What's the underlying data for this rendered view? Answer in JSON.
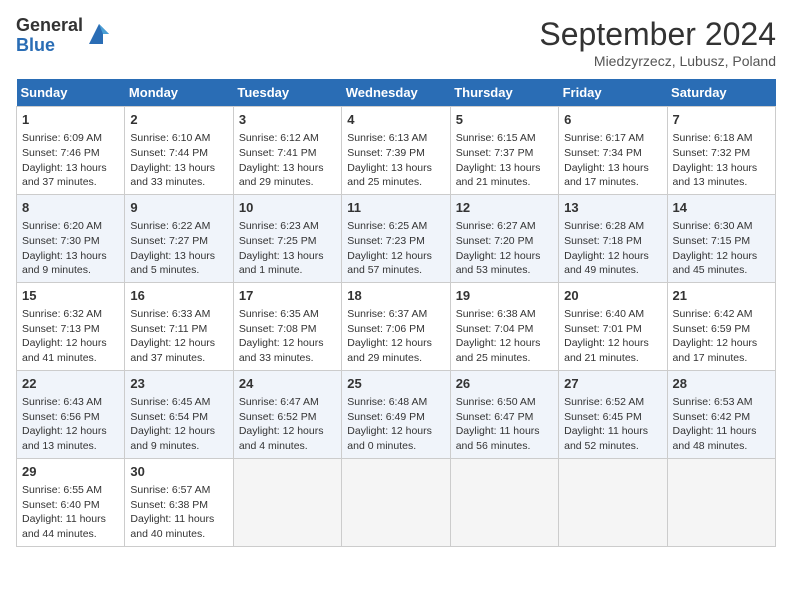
{
  "logo": {
    "general": "General",
    "blue": "Blue"
  },
  "header": {
    "month": "September 2024",
    "location": "Miedzyrzecz, Lubusz, Poland"
  },
  "weekdays": [
    "Sunday",
    "Monday",
    "Tuesday",
    "Wednesday",
    "Thursday",
    "Friday",
    "Saturday"
  ],
  "weeks": [
    [
      {
        "day": "1",
        "info": "Sunrise: 6:09 AM\nSunset: 7:46 PM\nDaylight: 13 hours\nand 37 minutes."
      },
      {
        "day": "2",
        "info": "Sunrise: 6:10 AM\nSunset: 7:44 PM\nDaylight: 13 hours\nand 33 minutes."
      },
      {
        "day": "3",
        "info": "Sunrise: 6:12 AM\nSunset: 7:41 PM\nDaylight: 13 hours\nand 29 minutes."
      },
      {
        "day": "4",
        "info": "Sunrise: 6:13 AM\nSunset: 7:39 PM\nDaylight: 13 hours\nand 25 minutes."
      },
      {
        "day": "5",
        "info": "Sunrise: 6:15 AM\nSunset: 7:37 PM\nDaylight: 13 hours\nand 21 minutes."
      },
      {
        "day": "6",
        "info": "Sunrise: 6:17 AM\nSunset: 7:34 PM\nDaylight: 13 hours\nand 17 minutes."
      },
      {
        "day": "7",
        "info": "Sunrise: 6:18 AM\nSunset: 7:32 PM\nDaylight: 13 hours\nand 13 minutes."
      }
    ],
    [
      {
        "day": "8",
        "info": "Sunrise: 6:20 AM\nSunset: 7:30 PM\nDaylight: 13 hours\nand 9 minutes."
      },
      {
        "day": "9",
        "info": "Sunrise: 6:22 AM\nSunset: 7:27 PM\nDaylight: 13 hours\nand 5 minutes."
      },
      {
        "day": "10",
        "info": "Sunrise: 6:23 AM\nSunset: 7:25 PM\nDaylight: 13 hours\nand 1 minute."
      },
      {
        "day": "11",
        "info": "Sunrise: 6:25 AM\nSunset: 7:23 PM\nDaylight: 12 hours\nand 57 minutes."
      },
      {
        "day": "12",
        "info": "Sunrise: 6:27 AM\nSunset: 7:20 PM\nDaylight: 12 hours\nand 53 minutes."
      },
      {
        "day": "13",
        "info": "Sunrise: 6:28 AM\nSunset: 7:18 PM\nDaylight: 12 hours\nand 49 minutes."
      },
      {
        "day": "14",
        "info": "Sunrise: 6:30 AM\nSunset: 7:15 PM\nDaylight: 12 hours\nand 45 minutes."
      }
    ],
    [
      {
        "day": "15",
        "info": "Sunrise: 6:32 AM\nSunset: 7:13 PM\nDaylight: 12 hours\nand 41 minutes."
      },
      {
        "day": "16",
        "info": "Sunrise: 6:33 AM\nSunset: 7:11 PM\nDaylight: 12 hours\nand 37 minutes."
      },
      {
        "day": "17",
        "info": "Sunrise: 6:35 AM\nSunset: 7:08 PM\nDaylight: 12 hours\nand 33 minutes."
      },
      {
        "day": "18",
        "info": "Sunrise: 6:37 AM\nSunset: 7:06 PM\nDaylight: 12 hours\nand 29 minutes."
      },
      {
        "day": "19",
        "info": "Sunrise: 6:38 AM\nSunset: 7:04 PM\nDaylight: 12 hours\nand 25 minutes."
      },
      {
        "day": "20",
        "info": "Sunrise: 6:40 AM\nSunset: 7:01 PM\nDaylight: 12 hours\nand 21 minutes."
      },
      {
        "day": "21",
        "info": "Sunrise: 6:42 AM\nSunset: 6:59 PM\nDaylight: 12 hours\nand 17 minutes."
      }
    ],
    [
      {
        "day": "22",
        "info": "Sunrise: 6:43 AM\nSunset: 6:56 PM\nDaylight: 12 hours\nand 13 minutes."
      },
      {
        "day": "23",
        "info": "Sunrise: 6:45 AM\nSunset: 6:54 PM\nDaylight: 12 hours\nand 9 minutes."
      },
      {
        "day": "24",
        "info": "Sunrise: 6:47 AM\nSunset: 6:52 PM\nDaylight: 12 hours\nand 4 minutes."
      },
      {
        "day": "25",
        "info": "Sunrise: 6:48 AM\nSunset: 6:49 PM\nDaylight: 12 hours\nand 0 minutes."
      },
      {
        "day": "26",
        "info": "Sunrise: 6:50 AM\nSunset: 6:47 PM\nDaylight: 11 hours\nand 56 minutes."
      },
      {
        "day": "27",
        "info": "Sunrise: 6:52 AM\nSunset: 6:45 PM\nDaylight: 11 hours\nand 52 minutes."
      },
      {
        "day": "28",
        "info": "Sunrise: 6:53 AM\nSunset: 6:42 PM\nDaylight: 11 hours\nand 48 minutes."
      }
    ],
    [
      {
        "day": "29",
        "info": "Sunrise: 6:55 AM\nSunset: 6:40 PM\nDaylight: 11 hours\nand 44 minutes."
      },
      {
        "day": "30",
        "info": "Sunrise: 6:57 AM\nSunset: 6:38 PM\nDaylight: 11 hours\nand 40 minutes."
      },
      {
        "day": "",
        "info": ""
      },
      {
        "day": "",
        "info": ""
      },
      {
        "day": "",
        "info": ""
      },
      {
        "day": "",
        "info": ""
      },
      {
        "day": "",
        "info": ""
      }
    ]
  ]
}
